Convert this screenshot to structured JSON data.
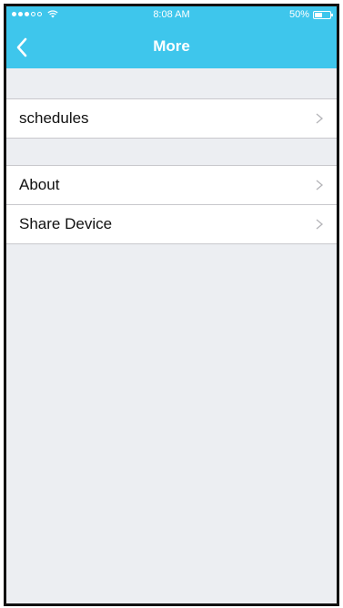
{
  "status_bar": {
    "time": "8:08 AM",
    "battery_percent": "50%",
    "battery_level": 0.5,
    "signal_bars": 3,
    "signal_total": 5
  },
  "nav": {
    "title": "More",
    "back_icon": "chevron-left-icon"
  },
  "sections": [
    {
      "items": [
        {
          "label": "schedules",
          "icon": "chevron-right-icon"
        }
      ]
    },
    {
      "items": [
        {
          "label": "About",
          "icon": "chevron-right-icon"
        },
        {
          "label": "Share Device",
          "icon": "chevron-right-icon"
        }
      ]
    }
  ],
  "colors": {
    "nav_bar": "#3ec6ec",
    "background": "#eceef2",
    "row_background": "#ffffff",
    "separator": "#c8c8cc"
  }
}
